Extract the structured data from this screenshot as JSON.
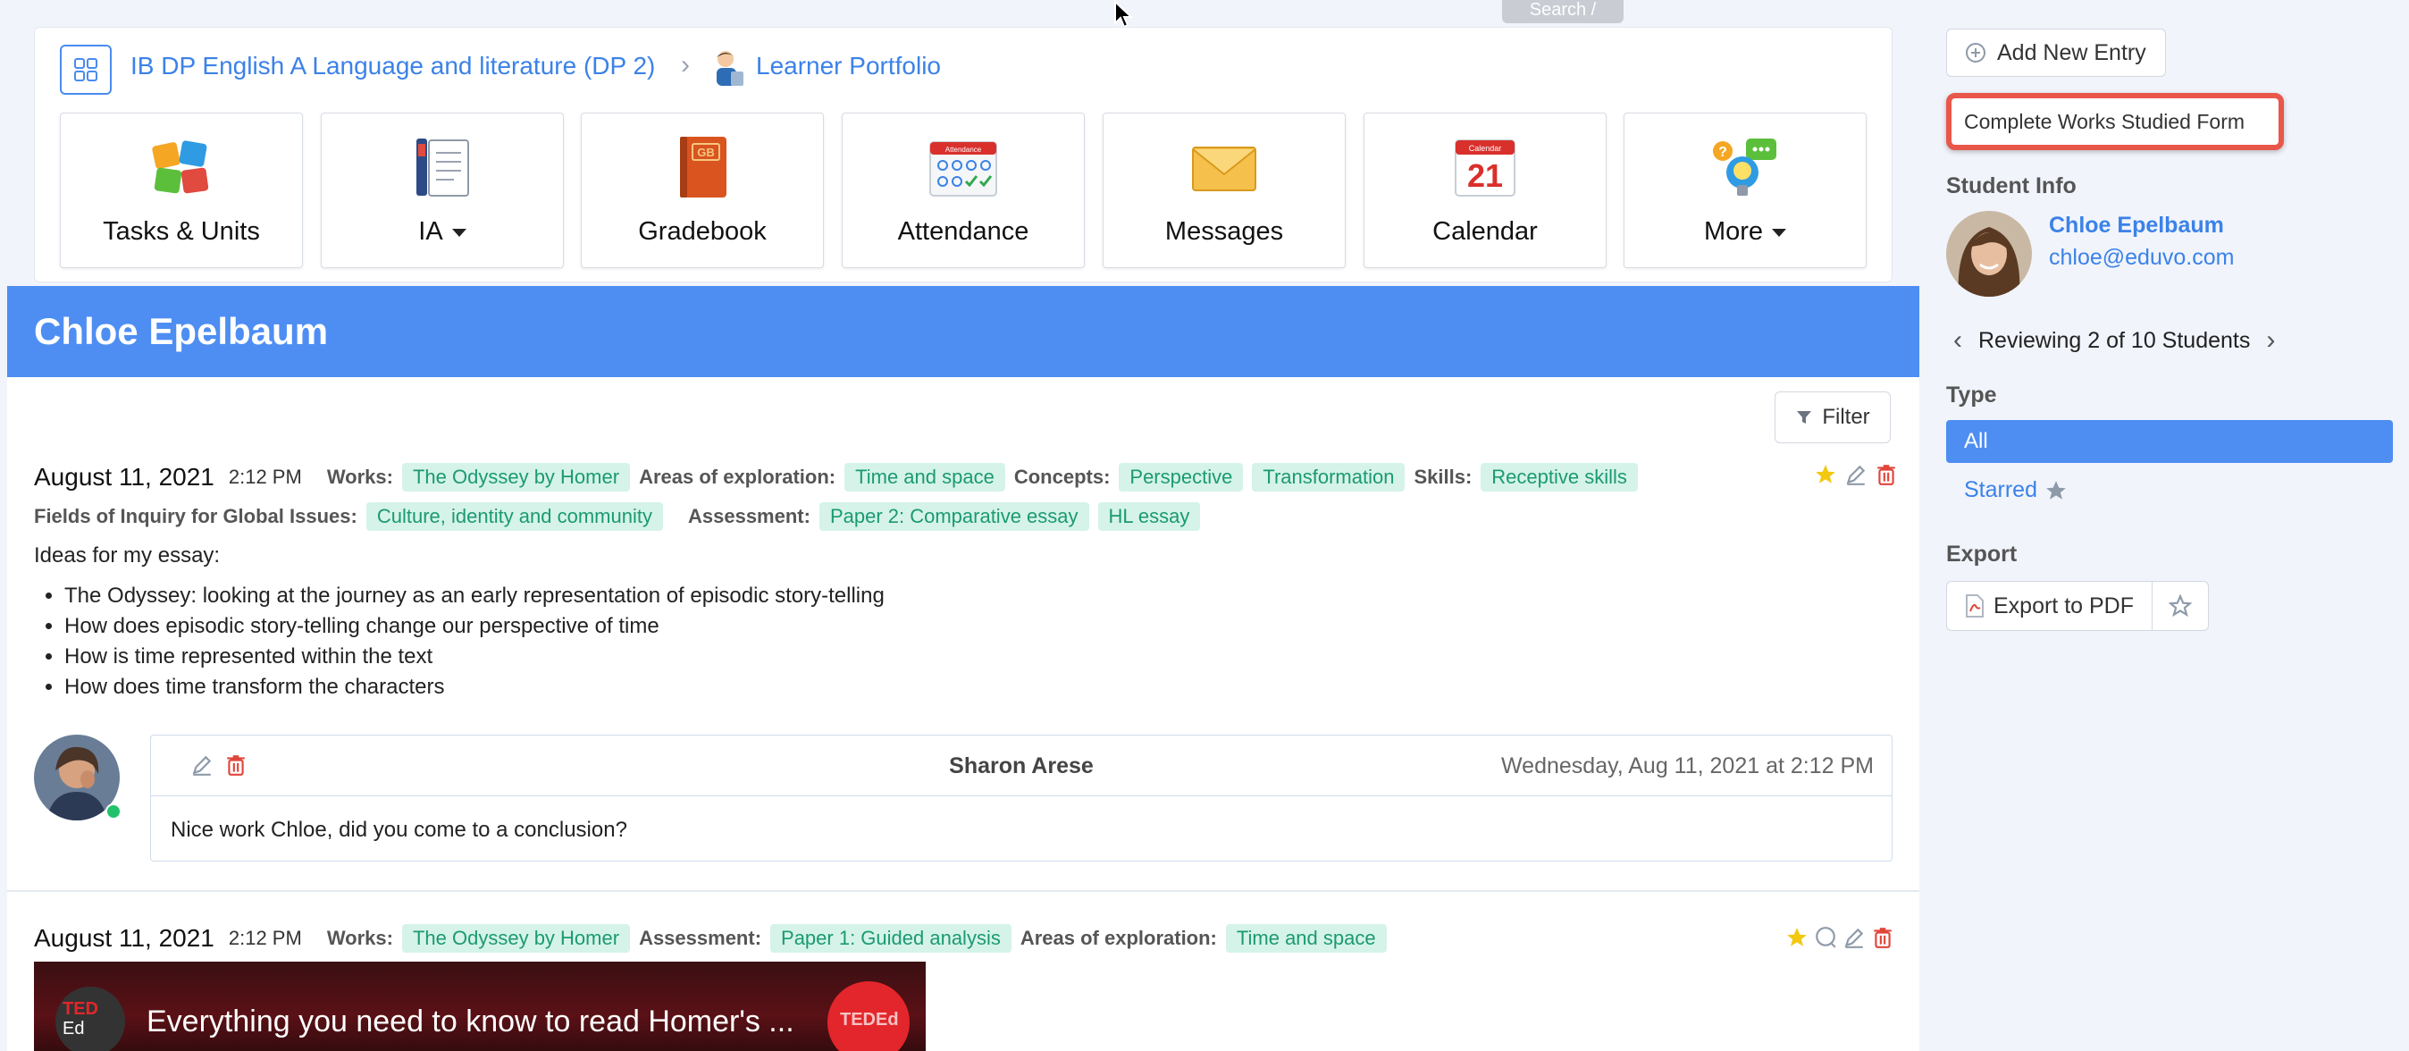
{
  "search_hint": "Search /",
  "breadcrumb": {
    "course": "IB DP English A Language and literature (DP 2)",
    "page": "Learner Portfolio"
  },
  "tiles": [
    {
      "label": "Tasks & Units",
      "icon": "puzzle-icon"
    },
    {
      "label": "IA",
      "icon": "ia-documents-icon",
      "dropdown": true
    },
    {
      "label": "Gradebook",
      "icon": "gradebook-icon",
      "badge": "GB"
    },
    {
      "label": "Attendance",
      "icon": "attendance-icon",
      "badge": "Attendance"
    },
    {
      "label": "Messages",
      "icon": "envelope-icon"
    },
    {
      "label": "Calendar",
      "icon": "calendar-icon",
      "badge": "Calendar",
      "day": "21"
    },
    {
      "label": "More",
      "icon": "more-ideas-icon",
      "dropdown": true
    }
  ],
  "student_banner": "Chloe Epelbaum",
  "filter_label": "Filter",
  "entries": [
    {
      "date": "August 11, 2021",
      "time": "2:12 PM",
      "works_label": "Works:",
      "works": "The Odyssey by Homer",
      "areas_label": "Areas of exploration:",
      "areas": "Time and space",
      "concepts_label": "Concepts:",
      "concepts": [
        "Perspective",
        "Transformation"
      ],
      "skills_label": "Skills:",
      "skills": "Receptive skills",
      "fields_label": "Fields of Inquiry for Global Issues:",
      "fields": "Culture, identity and community",
      "assessment_label": "Assessment:",
      "assessment": [
        "Paper 2: Comparative essay",
        "HL essay"
      ],
      "intro": "Ideas for my essay:",
      "bullets": [
        "The Odyssey: looking at the journey as an early representation of episodic story-telling",
        "How does episodic story-telling change our perspective of time",
        "How is time represented within the text",
        "How does time transform the characters"
      ],
      "comment": {
        "author": "Sharon Arese",
        "date": "Wednesday, Aug 11, 2021 at 2:12 PM",
        "text": "Nice work Chloe, did you come to a conclusion?"
      }
    },
    {
      "date": "August 11, 2021",
      "time": "2:12 PM",
      "works_label": "Works:",
      "works": "The Odyssey by Homer",
      "assessment_label": "Assessment:",
      "assessment": "Paper 1: Guided analysis",
      "areas_label": "Areas of exploration:",
      "areas": "Time and space",
      "video_title": "Everything you need to know to read Homer's ...",
      "video_badge_top": "TED",
      "video_badge_bottom": "Ed",
      "video_corner": "TEDEd"
    }
  ],
  "sidebar": {
    "add_entry": "Add New Entry",
    "complete_form": "Complete Works Studied Form",
    "student_info_heading": "Student Info",
    "student_name": "Chloe Epelbaum",
    "student_email": "chloe@eduvo.com",
    "reviewing": "Reviewing 2 of 10 Students",
    "type_heading": "Type",
    "type_all": "All",
    "type_starred": "Starred",
    "export_heading": "Export",
    "export_pdf": "Export to PDF"
  },
  "colors": {
    "accent": "#4e8ef3",
    "link": "#3b82e8",
    "tag_bg": "#d5f3e9",
    "tag_text": "#1b9a71",
    "highlight_border": "#e8574a",
    "star": "#f2c811",
    "delete": "#e0463a"
  }
}
